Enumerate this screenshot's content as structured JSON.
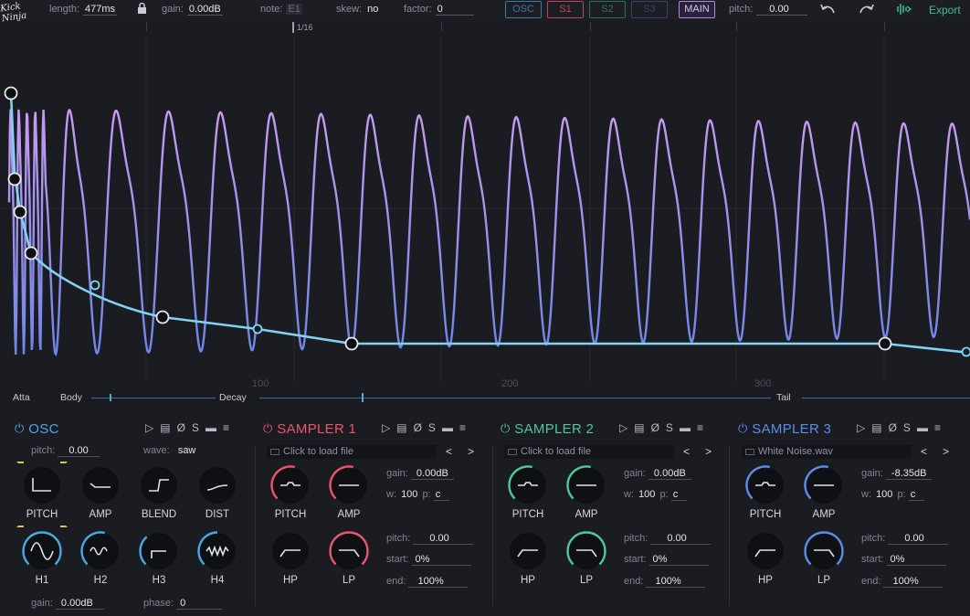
{
  "app": {
    "logo_text": "Kick Ninja"
  },
  "topbar": {
    "length_label": "length:",
    "length_value": "477ms",
    "gain_label": "gain:",
    "gain_value": "0.00dB",
    "note_label": "note:",
    "note_value": "E1",
    "skew_label": "skew:",
    "skew_value": "no",
    "factor_label": "factor:",
    "factor_value": "0",
    "modes": [
      {
        "label": "OSC",
        "color": "#3f7a9c"
      },
      {
        "label": "S1",
        "color": "#b64860"
      },
      {
        "label": "S2",
        "color": "#2f6e5a"
      },
      {
        "label": "S3",
        "color": "#34436e"
      },
      {
        "label": "MAIN",
        "color": "#b088e0"
      }
    ],
    "pitch_label": "pitch:",
    "pitch_value": "0.00",
    "export_label": "Export",
    "undo_icon": "undo-icon",
    "redo_icon": "redo-icon"
  },
  "ruler": {
    "division": "1/16"
  },
  "waveform": {
    "axis_labels": [
      "100",
      "200",
      "300"
    ],
    "wave_color_start": "#c79bf0",
    "wave_color_end": "#6d86e8",
    "envelope_color": "#7fd2f0"
  },
  "segments": [
    "Atta",
    "Body",
    "Decay",
    "Tail"
  ],
  "osc": {
    "title": "OSC",
    "color": "#4aa8e0",
    "pitch_label": "pitch:",
    "pitch_value": "0.00",
    "wave_label": "wave:",
    "wave_value": "saw",
    "knobs": [
      "PITCH",
      "AMP",
      "BLEND",
      "DIST",
      "H1",
      "H2",
      "H3",
      "H4"
    ],
    "gain_label": "gain:",
    "gain_value": "0.00dB",
    "phase_label": "phase:",
    "phase_value": "0"
  },
  "samplers": [
    {
      "title": "SAMPLER 1",
      "color": "#e8566d",
      "file": "Click to load file",
      "gain_label": "gain:",
      "gain_value": "0.00dB",
      "w_label": "w:",
      "w_value": "100",
      "p_label": "p:",
      "p_value": "c",
      "pitch_label": "pitch:",
      "pitch_value": "0.00",
      "start_label": "start:",
      "start_value": "0%",
      "end_label": "end:",
      "end_value": "100%",
      "knobs": [
        "PITCH",
        "AMP",
        "HP",
        "LP"
      ]
    },
    {
      "title": "SAMPLER 2",
      "color": "#4fc79a",
      "file": "Click to load file",
      "gain_label": "gain:",
      "gain_value": "0.00dB",
      "w_label": "w:",
      "w_value": "100",
      "p_label": "p:",
      "p_value": "c",
      "pitch_label": "pitch:",
      "pitch_value": "0.00",
      "start_label": "start:",
      "start_value": "0%",
      "end_label": "end:",
      "end_value": "100%",
      "knobs": [
        "PITCH",
        "AMP",
        "HP",
        "LP"
      ]
    },
    {
      "title": "SAMPLER 3",
      "color": "#5a8ee6",
      "file": "White Noise.wav",
      "gain_label": "gain:",
      "gain_value": "-8.35dB",
      "w_label": "w:",
      "w_value": "100",
      "p_label": "p:",
      "p_value": "c",
      "pitch_label": "pitch:",
      "pitch_value": "0.00",
      "start_label": "start:",
      "start_value": "0%",
      "end_label": "end:",
      "end_value": "100%",
      "knobs": [
        "PITCH",
        "AMP",
        "HP",
        "LP"
      ]
    }
  ],
  "panel_tools": [
    "play-icon",
    "save-icon",
    "phase-invert-icon",
    "solo-icon",
    "lock-icon",
    "menu-icon"
  ]
}
